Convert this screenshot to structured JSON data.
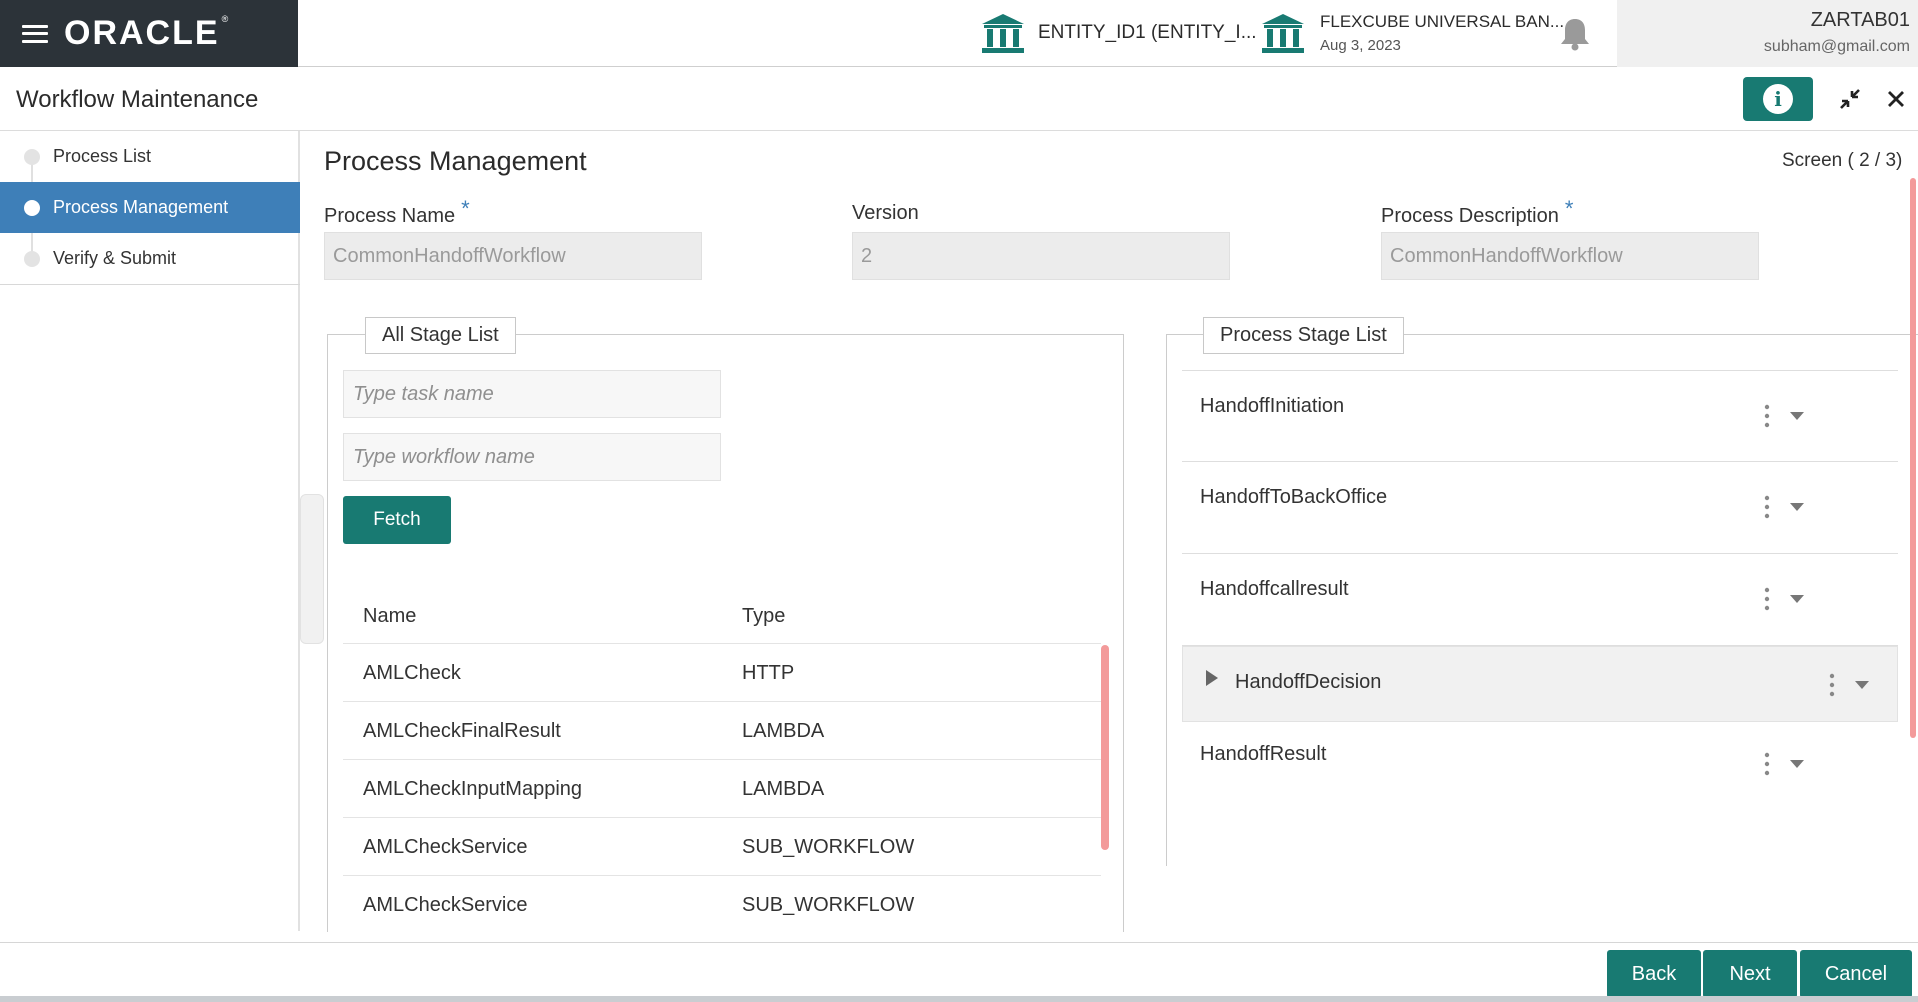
{
  "header": {
    "brand": "ORACLE",
    "entity1": {
      "label": "ENTITY_ID1  (ENTITY_I...",
      "icon": "bank-icon"
    },
    "entity2": {
      "name": "FLEXCUBE UNIVERSAL BAN...",
      "date": "Aug 3, 2023",
      "icon": "bank-icon"
    },
    "user": {
      "id": "ZARTAB01",
      "email": "subham@gmail.com"
    },
    "colors": {
      "brand_bg": "#2c3339",
      "accent": "#187a72",
      "icon": "#187a72"
    }
  },
  "window": {
    "title": "Workflow Maintenance",
    "info_icon": "info-icon",
    "collapse_icon": "collapse-icon",
    "close_icon": "close-icon"
  },
  "nav": {
    "items": [
      {
        "label": "Process List",
        "active": false
      },
      {
        "label": "Process Management",
        "active": true
      },
      {
        "label": "Verify & Submit",
        "active": false
      }
    ],
    "active_color": "#3e7fb8"
  },
  "main": {
    "title": "Process Management",
    "screen": "Screen ( 2 / 3)",
    "fields": {
      "process_name": {
        "label": "Process Name",
        "value": "CommonHandoffWorkflow",
        "required_mark": "*"
      },
      "version": {
        "label": "Version",
        "value": "2"
      },
      "process_description": {
        "label": "Process Description",
        "value": "CommonHandoffWorkflow",
        "required_mark": "*"
      }
    }
  },
  "all_stage_list": {
    "legend": "All Stage List",
    "task_placeholder": "Type task name",
    "workflow_placeholder": "Type workflow name",
    "fetch_label": "Fetch",
    "columns": [
      "Name",
      "Type"
    ],
    "rows": [
      {
        "name": "AMLCheck",
        "type": "HTTP"
      },
      {
        "name": "AMLCheckFinalResult",
        "type": "LAMBDA"
      },
      {
        "name": "AMLCheckInputMapping",
        "type": "LAMBDA"
      },
      {
        "name": "AMLCheckService",
        "type": "SUB_WORKFLOW"
      },
      {
        "name": "AMLCheckService",
        "type": "SUB_WORKFLOW"
      }
    ]
  },
  "process_stage_list": {
    "legend": "Process Stage List",
    "stages": [
      {
        "name": "HandoffInitiation"
      },
      {
        "name": "HandoffToBackOffice"
      },
      {
        "name": "Handoffcallresult"
      },
      {
        "name": "HandoffDecision",
        "expanded": true
      },
      {
        "name": "HandoffResult"
      }
    ]
  },
  "footer": {
    "back_label": "Back",
    "next_label": "Next",
    "cancel_label": "Cancel"
  }
}
